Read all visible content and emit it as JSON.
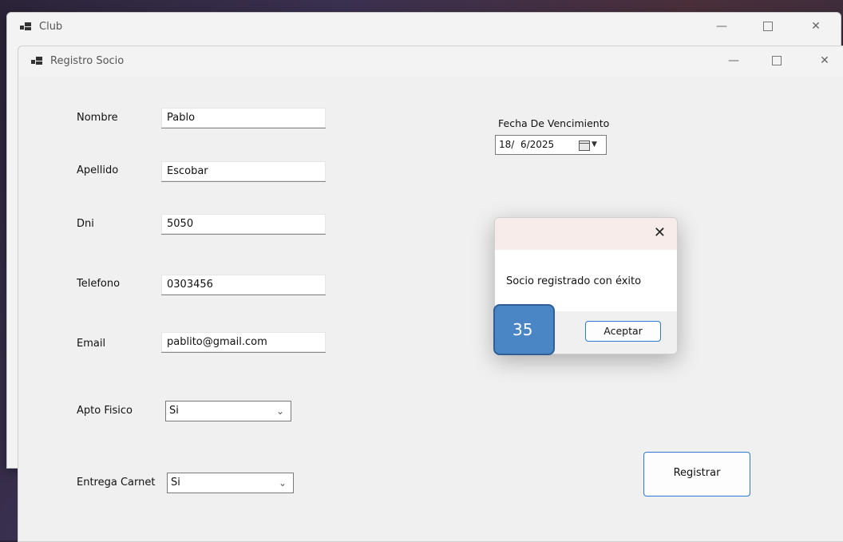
{
  "outer_window": {
    "title": "Club",
    "controls": {
      "minimize": "—",
      "close": "✕"
    }
  },
  "form_window": {
    "title": "Registro Socio",
    "controls": {
      "minimize": "—",
      "close": "✕"
    },
    "fields": {
      "nombre": {
        "label": "Nombre",
        "value": "Pablo"
      },
      "apellido": {
        "label": "Apellido",
        "value": "Escobar"
      },
      "dni": {
        "label": "Dni",
        "value": "5050"
      },
      "telefono": {
        "label": "Telefono",
        "value": "0303456"
      },
      "email": {
        "label": "Email",
        "value": "pablito@gmail.com"
      },
      "apto_fisico": {
        "label": "Apto Fisico",
        "selected": "Si"
      },
      "entrega_carnet": {
        "label": "Entrega Carnet",
        "selected": "Si"
      },
      "fecha_vencimiento": {
        "label": "Fecha De Vencimiento",
        "value": "18/  6/2025"
      }
    },
    "registrar_button": "Registrar"
  },
  "message_box": {
    "message": "Socio registrado con éxito",
    "close": "✕",
    "ok_button": "Aceptar"
  },
  "step_badge": "35",
  "icons": {
    "app": "app-window-icon",
    "calendar": "calendar-icon",
    "dropdown": "chevron-down-icon"
  }
}
